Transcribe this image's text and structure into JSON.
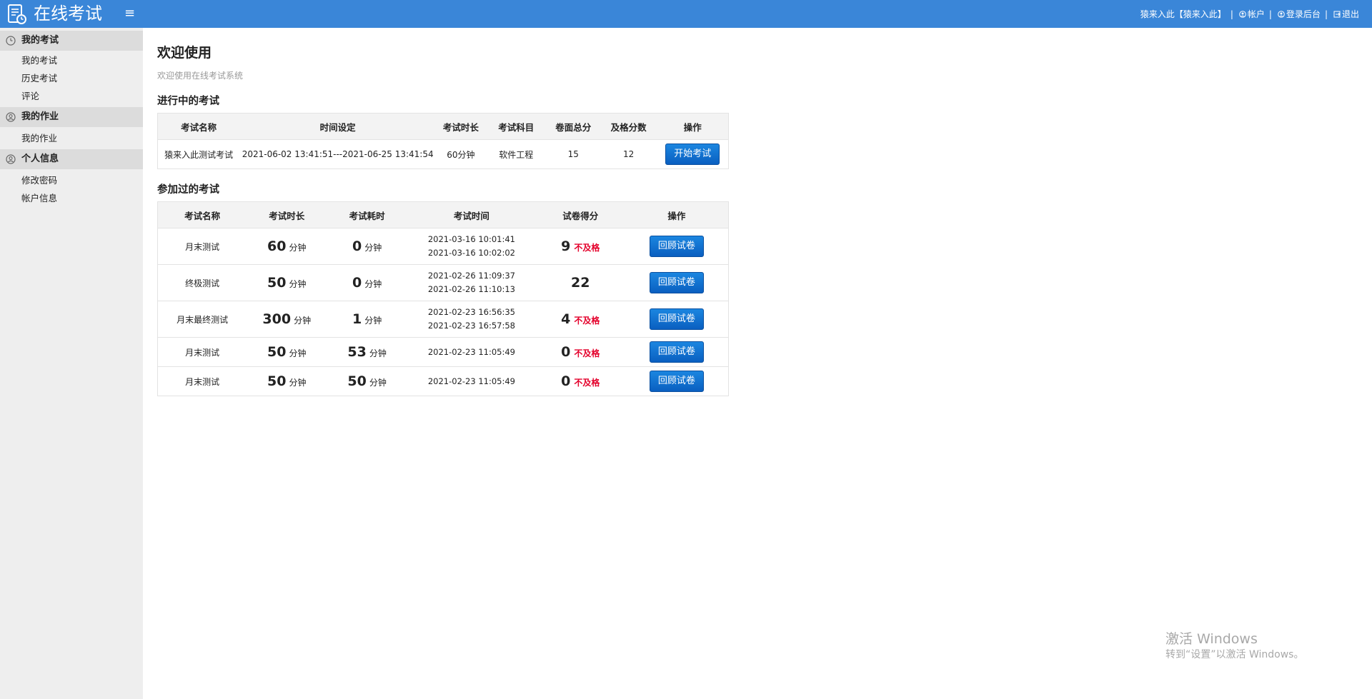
{
  "header": {
    "app_title": "在线考试",
    "menu_icon": "hamburger-icon",
    "user_label": "猿来入此【猿来入此】",
    "account_label": "帐户",
    "admin_label": "登录后台",
    "logout_label": "退出",
    "separator": "|"
  },
  "sidebar": {
    "groups": [
      {
        "label": "我的考试",
        "icon": "clock-icon",
        "items": [
          {
            "label": "我的考试"
          },
          {
            "label": "历史考试"
          },
          {
            "label": "评论"
          }
        ]
      },
      {
        "label": "我的作业",
        "icon": "user-circle-icon",
        "items": [
          {
            "label": "我的作业"
          }
        ]
      },
      {
        "label": "个人信息",
        "icon": "user-circle-icon",
        "items": [
          {
            "label": "修改密码"
          },
          {
            "label": "帐户信息"
          }
        ]
      }
    ]
  },
  "main": {
    "title": "欢迎使用",
    "subtitle": "欢迎使用在线考试系统",
    "ongoing": {
      "title": "进行中的考试",
      "columns": [
        "考试名称",
        "时间设定",
        "考试时长",
        "考试科目",
        "卷面总分",
        "及格分数",
        "操作"
      ],
      "rows": [
        {
          "name": "猿来入此测试考试",
          "time": "2021-06-02 13:41:51---2021-06-25 13:41:54",
          "duration": "60分钟",
          "subject": "软件工程",
          "total": "15",
          "pass": "12",
          "action": "开始考试"
        }
      ]
    },
    "history": {
      "title": "参加过的考试",
      "columns": [
        "考试名称",
        "考试时长",
        "考试耗时",
        "考试时间",
        "试卷得分",
        "操作"
      ],
      "unit": "分钟",
      "fail_label": "不及格",
      "rows": [
        {
          "name": "月末测试",
          "duration": "60",
          "used": "0",
          "start": "2021-03-16 10:01:41",
          "end": "2021-03-16 10:02:02",
          "score": "9",
          "status": "不及格",
          "action": "回顾试卷"
        },
        {
          "name": "终极测试",
          "duration": "50",
          "used": "0",
          "start": "2021-02-26 11:09:37",
          "end": "2021-02-26 11:10:13",
          "score": "22",
          "status": "",
          "action": "回顾试卷"
        },
        {
          "name": "月末最终测试",
          "duration": "300",
          "used": "1",
          "start": "2021-02-23 16:56:35",
          "end": "2021-02-23 16:57:58",
          "score": "4",
          "status": "不及格",
          "action": "回顾试卷"
        },
        {
          "name": "月末测试",
          "duration": "50",
          "used": "53",
          "start": "2021-02-23 11:05:49",
          "end": "",
          "score": "0",
          "status": "不及格",
          "action": "回顾试卷"
        },
        {
          "name": "月末测试",
          "duration": "50",
          "used": "50",
          "start": "2021-02-23 11:05:49",
          "end": "",
          "score": "0",
          "status": "不及格",
          "action": "回顾试卷"
        }
      ]
    }
  },
  "watermark": {
    "line1": "激活 Windows",
    "line2": "转到“设置”以激活 Windows。"
  },
  "colors": {
    "header_bg": "#3a86d8",
    "sidebar_bg": "#eeeeee",
    "button_bg": "#0a6ad0",
    "fail": "#e4002b"
  }
}
